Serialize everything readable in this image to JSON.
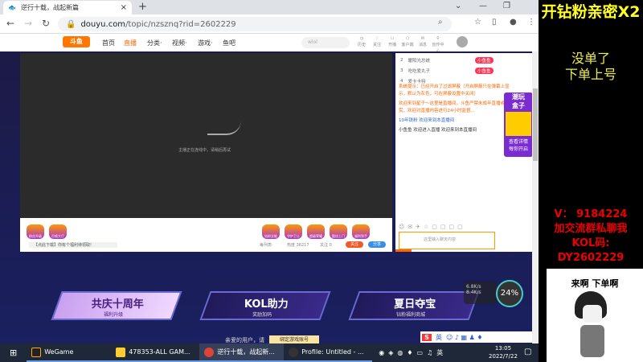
{
  "browser": {
    "tab_title": "逆行十载，战起新篇",
    "url_host": "douyu.com",
    "url_path": "/topic/nzsznq?rid=2602229",
    "new_tab": "+",
    "close": "×"
  },
  "site": {
    "logo": "斗鱼",
    "nav": [
      "首页",
      "直播",
      "分类·",
      "视频·",
      "游戏·",
      "鱼吧"
    ],
    "search_placeholder": "wlol",
    "header_icons": [
      "历史",
      "关注",
      "开播",
      "客户端",
      "消息",
      "创作中心"
    ]
  },
  "player": {
    "loading_text": "主播正在连线中，请稍后再试",
    "gifts_left": [
      "粉丝升级",
      "召唤大厅"
    ],
    "gifts_right": [
      "钻粉全能",
      "守护卫士",
      "超级荣耀",
      "酷炫上门",
      "福利到手"
    ],
    "ticker": "【点此下载】你有个福利待领取!",
    "stats": [
      "每列表·",
      "热度 36217",
      "关注 0"
    ],
    "btn_follow": "关注",
    "btn_share": "分享"
  },
  "chat": {
    "ranks": [
      {
        "n": "2",
        "name": "暖阳光总统"
      },
      {
        "n": "3",
        "name": "吃吃爱丸子"
      },
      {
        "n": "4",
        "name": "爱卡卡特"
      }
    ],
    "rank_badge": "小鱼鱼",
    "messages": [
      "系统提示：已经开启了过滤屏蔽（开启屏蔽只在弹幕上显示，默认为灰色，可在屏蔽设置中关闭）",
      "欢迎来到星子～这里是直播间，斗鱼严禁未成年直播或打赏，欢迎对直播内容进行24小时监督...",
      "10年铁粉 欢迎来到本直播间",
      "小鱼鱼 欢迎进入直播 欢迎来到本直播间"
    ],
    "promo": [
      "潮玩",
      "盒子",
      "查看详情",
      "每你开启"
    ],
    "input_placeholder": "这里输入聊天内容"
  },
  "banners": [
    {
      "title": "共庆十周年",
      "sub": "福利升级"
    },
    {
      "title": "KOL助力",
      "sub": "奖励加码"
    },
    {
      "title": "夏日夺宝",
      "sub": "钻粉福利商城"
    }
  ],
  "netmon": {
    "up": "6.8K/s",
    "down": "8.4K/s",
    "cpu": "24%"
  },
  "footer": {
    "cookie_text": "亲爱的用户，请",
    "cookie_btn": "绑定游戏账号"
  },
  "ime": {
    "logo": "S",
    "lang": "英"
  },
  "taskbar": {
    "items": [
      "WeGame",
      "478353-ALL GAM...",
      "逆行十载，战起新...",
      "Profile: Untitled - ..."
    ],
    "tray_lang": "英",
    "time": "13:05",
    "date": "2022/7/22"
  },
  "overlay": {
    "line1": "开钻粉亲密X2",
    "line2a": "没单了",
    "line2b": "下单上号",
    "v": "V：  9184224",
    "group": "加交流群私聊我",
    "kol_label": "KOL码:",
    "kol_code": "DY2602229",
    "meme_text": "来啊 下单啊"
  }
}
